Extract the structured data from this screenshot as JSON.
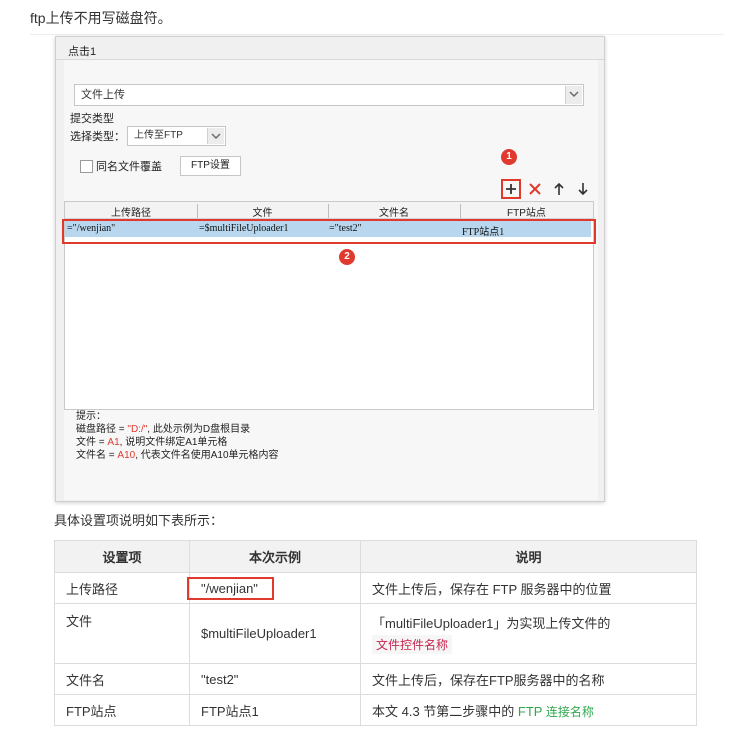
{
  "intro_text": "ftp上传不用写磁盘符。",
  "dialog": {
    "title": "点击1",
    "action_select": "文件上传",
    "submit_type_label": "提交类型",
    "select_type_label": "选择类型：",
    "select_type_value": "上传至FTP",
    "same_name_overwrite_label": "同名文件覆盖",
    "same_name_overwrite_checked": false,
    "ftp_settings_button": "FTP设置",
    "badge1": "1",
    "badge2": "2",
    "grid": {
      "columns": [
        "上传路径",
        "文件",
        "文件名",
        "FTP站点"
      ],
      "rows": [
        [
          "=\"/wenjian\"",
          "=$multiFileUploader1",
          "=\"test2\"",
          "FTP站点1"
        ]
      ]
    },
    "hint": {
      "title": "提示：",
      "line1_prefix": "磁盘路径 = ",
      "line1_value": "\"D:/\"",
      "line1_suffix": ", 此处示例为D盘根目录",
      "line2_prefix": "文件 = ",
      "line2_value": "A1",
      "line2_suffix": ", 说明文件绑定A1单元格",
      "line3_prefix": "文件名 = ",
      "line3_value": "A10",
      "line3_suffix": ", 代表文件名使用A10单元格内容"
    },
    "icons": [
      "add-icon",
      "delete-icon",
      "arrow-up-icon",
      "arrow-down-icon",
      "chevron-down-icon"
    ],
    "accent_color": "#e03a2f",
    "selection_color": "#b8d7ee"
  },
  "desc_text": "具体设置项说明如下表所示：",
  "table": {
    "headers": [
      "设置项",
      "本次示例",
      "说明"
    ],
    "rows": [
      {
        "item": "上传路径",
        "example": "\"/wenjian\"",
        "desc": "文件上传后，保存在 FTP 服务器中的位置"
      },
      {
        "item": "文件",
        "example": "$multiFileUploader1",
        "desc": "「multiFileUploader1」为实现上传文件的",
        "desc_code": "文件控件名称"
      },
      {
        "item": "文件名",
        "example": "\"test2\"",
        "desc": "文件上传后，保存在FTP服务器中的名称"
      },
      {
        "item": "FTP站点",
        "example": "FTP站点1",
        "desc": "本文 4.3 节第二步骤中的 ",
        "desc_link1": "FTP",
        "desc_link2": " 连接名称"
      }
    ]
  }
}
